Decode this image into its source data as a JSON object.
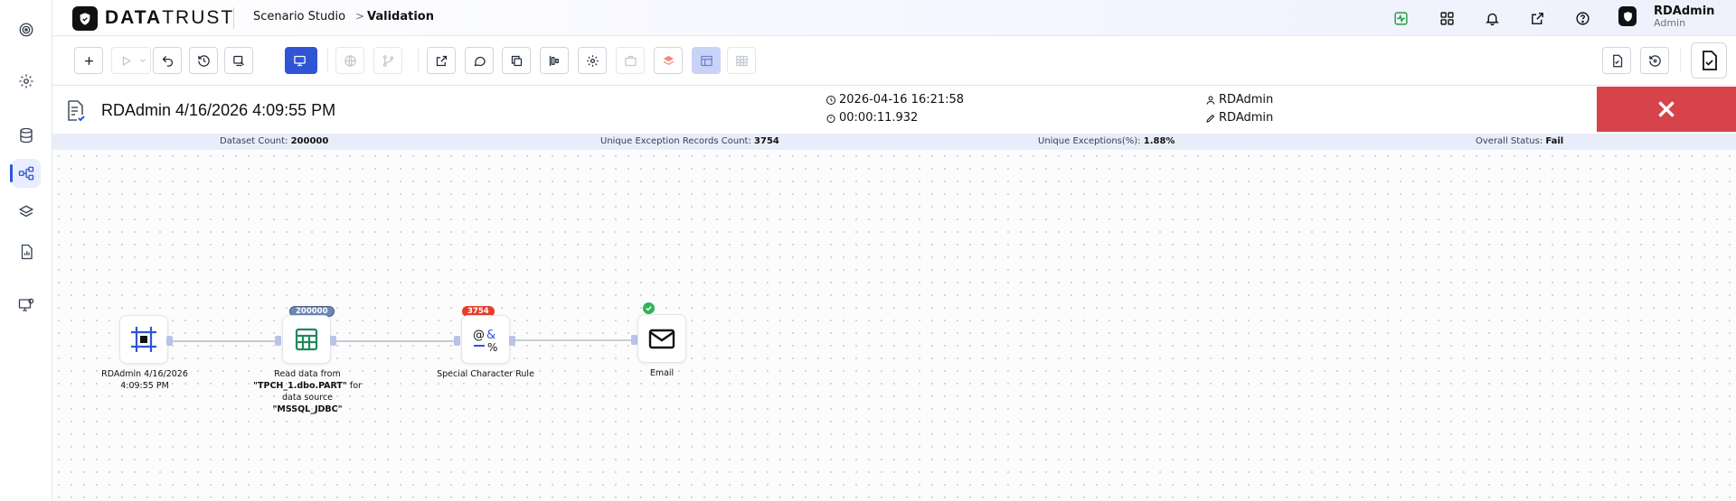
{
  "brand": {
    "logo_text_bold": "DATA",
    "logo_text_light": "TRUST"
  },
  "breadcrumb": {
    "item1": "Scenario Studio",
    "separator": ">",
    "item2": "Validation"
  },
  "user": {
    "name": "RDAdmin",
    "role": "Admin"
  },
  "left_rail": [
    {
      "icon": "target-icon"
    },
    {
      "icon": "gear-icon"
    },
    {
      "icon": "database-icon"
    },
    {
      "icon": "workflow-icon"
    },
    {
      "icon": "layers-icon"
    },
    {
      "icon": "report-icon"
    },
    {
      "icon": "monitor-settings-icon"
    }
  ],
  "run": {
    "title": "RDAdmin 4/16/2026 4:09:55 PM",
    "start_time": "2026-04-16 16:21:58",
    "duration": "00:00:11.932",
    "created_by": "RDAdmin",
    "modified_by": "RDAdmin"
  },
  "stats": {
    "dataset_label": "Dataset Count:",
    "dataset_value": "200000",
    "unique_records_label": "Unique Exception Records Count:",
    "unique_records_value": "3754",
    "unique_pct_label": "Unique Exceptions(%):",
    "unique_pct_value": "1.88%",
    "status_label": "Overall Status:",
    "status_value": "Fail"
  },
  "nodes": {
    "n1": {
      "label": "RDAdmin 4/16/2026 4:09:55 PM"
    },
    "n2": {
      "badge": "200000",
      "label_pre": "Read data from ",
      "label_bold1": "\"TPCH_1.dbo.PART\"",
      "label_mid": " for data source ",
      "label_bold2": "\"MSSQL_JDBC\""
    },
    "n3": {
      "badge": "3754",
      "label": "Special Character Rule"
    },
    "n4": {
      "label": "Email"
    }
  },
  "colors": {
    "accent": "#2f55d4",
    "fail": "#d6434a",
    "success": "#2fb457",
    "badge_red": "#e53e2b"
  }
}
